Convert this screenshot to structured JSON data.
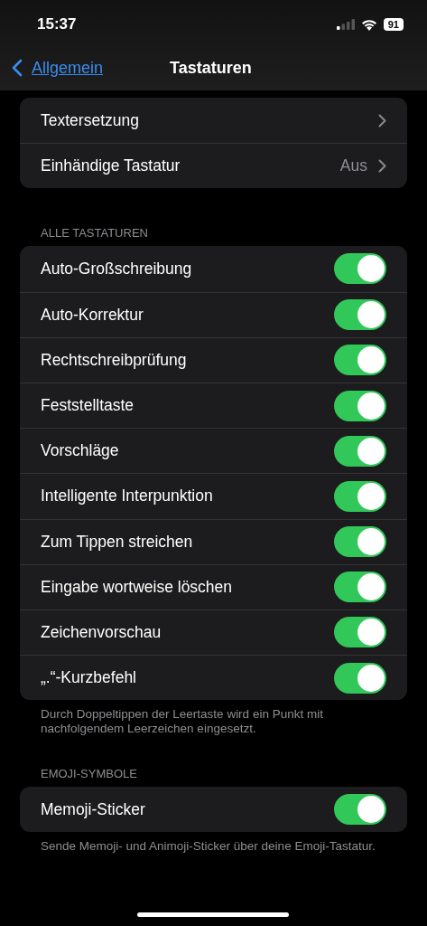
{
  "status_bar": {
    "time": "15:37",
    "battery": "91"
  },
  "nav": {
    "back": "Allgemein",
    "title": "Tastaturen"
  },
  "sections": [
    {
      "rows": [
        {
          "kind": "link",
          "label": "Textersetzung"
        },
        {
          "kind": "link",
          "label": "Einhändige Tastatur",
          "value": "Aus"
        }
      ]
    },
    {
      "header": "ALLE TASTATUREN",
      "rows": [
        {
          "kind": "toggle",
          "label": "Auto-Großschreibung",
          "on": true
        },
        {
          "kind": "toggle",
          "label": "Auto-Korrektur",
          "on": true
        },
        {
          "kind": "toggle",
          "label": "Rechtschreibprüfung",
          "on": true
        },
        {
          "kind": "toggle",
          "label": "Feststelltaste",
          "on": true
        },
        {
          "kind": "toggle",
          "label": "Vorschläge",
          "on": true
        },
        {
          "kind": "toggle",
          "label": "Intelligente Interpunktion",
          "on": true
        },
        {
          "kind": "toggle",
          "label": "Zum Tippen streichen",
          "on": true
        },
        {
          "kind": "toggle",
          "label": "Eingabe wortweise löschen",
          "on": true
        },
        {
          "kind": "toggle",
          "label": "Zeichenvorschau",
          "on": true
        },
        {
          "kind": "toggle",
          "label": "„.“-Kurzbefehl",
          "on": true
        }
      ],
      "footer": "Durch Doppeltippen der Leertaste wird ein Punkt mit nachfolgendem Leerzeichen eingesetzt."
    },
    {
      "header": "EMOJI-SYMBOLE",
      "rows": [
        {
          "kind": "toggle",
          "label": "Memoji-Sticker",
          "on": true
        }
      ],
      "footer": "Sende Memoji- und Animoji-Sticker über deine Emoji-Tastatur."
    }
  ]
}
